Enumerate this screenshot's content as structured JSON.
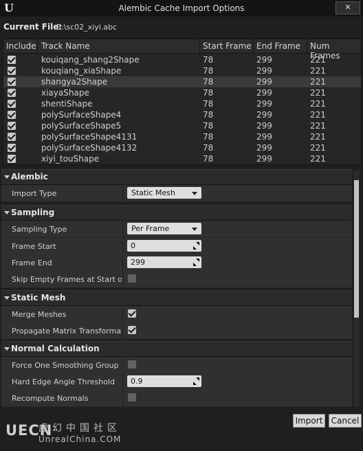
{
  "window": {
    "title": "Alembic Cache Import Options",
    "close_icon": "close-icon"
  },
  "current_file": {
    "label": "Current File:",
    "value": "E:\\sc02_xiyi.abc"
  },
  "table": {
    "headers": [
      "Include",
      "Track Name",
      "Start Frame",
      "End Frame",
      "Num Frames"
    ],
    "selected_row": 2,
    "rows": [
      {
        "include": true,
        "name": "kouiqang_shang2Shape",
        "start": "78",
        "end": "299",
        "num": "221"
      },
      {
        "include": true,
        "name": "kouqiang_xiaShape",
        "start": "78",
        "end": "299",
        "num": "221"
      },
      {
        "include": true,
        "name": "shangya2Shape",
        "start": "78",
        "end": "299",
        "num": "221"
      },
      {
        "include": true,
        "name": "xiayaShape",
        "start": "78",
        "end": "299",
        "num": "221"
      },
      {
        "include": true,
        "name": "shentiShape",
        "start": "78",
        "end": "299",
        "num": "221"
      },
      {
        "include": true,
        "name": "polySurfaceShape4",
        "start": "78",
        "end": "299",
        "num": "221"
      },
      {
        "include": true,
        "name": "polySurfaceShape5",
        "start": "78",
        "end": "299",
        "num": "221"
      },
      {
        "include": true,
        "name": "polySurfaceShape4131",
        "start": "78",
        "end": "299",
        "num": "221"
      },
      {
        "include": true,
        "name": "polySurfaceShape4132",
        "start": "78",
        "end": "299",
        "num": "221"
      },
      {
        "include": true,
        "name": "xiyi_touShape",
        "start": "78",
        "end": "299",
        "num": "221"
      }
    ]
  },
  "sections": {
    "alembic": {
      "title": "Alembic",
      "import_type_label": "Import Type",
      "import_type_value": "Static Mesh"
    },
    "sampling": {
      "title": "Sampling",
      "sampling_type_label": "Sampling Type",
      "sampling_type_value": "Per Frame",
      "frame_start_label": "Frame Start",
      "frame_start_value": "0",
      "frame_end_label": "Frame End",
      "frame_end_value": "299",
      "skip_empty_label": "Skip Empty Frames at Start of A",
      "skip_empty_checked": false
    },
    "static_mesh": {
      "title": "Static Mesh",
      "merge_meshes_label": "Merge Meshes",
      "merge_meshes_checked": true,
      "propagate_label": "Propagate Matrix Transformatio",
      "propagate_checked": true
    },
    "normal_calculation": {
      "title": "Normal Calculation",
      "force_smoothing_label": "Force One Smoothing Group Per",
      "force_smoothing_checked": false,
      "hard_edge_label": "Hard Edge Angle Threshold",
      "hard_edge_value": "0.9",
      "recompute_label": "Recompute Normals",
      "recompute_checked": false
    }
  },
  "buttons": {
    "import": "Import",
    "cancel": "Cancel"
  },
  "watermark": {
    "logo": "UECN",
    "chinese": "虚幻中国社区",
    "url": "UnrealChina.COM"
  },
  "colors": {
    "background": "#1f1f1f",
    "panel": "#303030",
    "input": "#dedede"
  }
}
